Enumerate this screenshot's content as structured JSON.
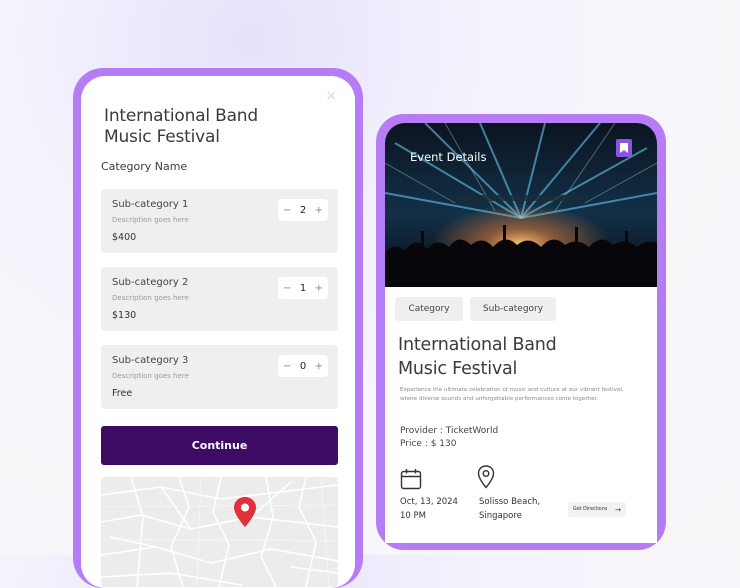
{
  "booking": {
    "title_line1": "International Band",
    "title_line2": "Music Festival",
    "close_label": "×",
    "category_name": "Category Name",
    "subcategories": [
      {
        "name": "Sub-category 1",
        "description": "Description goes here",
        "price": "$400",
        "quantity": "2"
      },
      {
        "name": "Sub-category 2",
        "description": "Description goes here",
        "price": "$130",
        "quantity": "1"
      },
      {
        "name": "Sub-category 3",
        "description": "Description goes here",
        "price": "Free",
        "quantity": "0"
      }
    ],
    "stepper_minus": "−",
    "stepper_plus": "+",
    "continue_label": "Continue",
    "map_pin_color": "#e0303a"
  },
  "event": {
    "header_title": "Event Details",
    "bookmark_icon": "bookmark-icon",
    "chips": [
      "Category",
      "Sub-category"
    ],
    "title_line1": "International Band",
    "title_line2": "Music Festival",
    "description": "Experience the ultimate celebration of music and culture at our vibrant festival, where diverse sounds and unforgettable performances come together.",
    "provider": "Provider : TicketWorld",
    "price": "Price : $ 130",
    "date_line1": "Oct, 13, 2024",
    "date_line2": "10 PM",
    "place_line1": "Solisso Beach,",
    "place_line2": "Singapore",
    "directions_label": "Get Directions",
    "directions_arrow": "→"
  },
  "colors": {
    "phone_frame": "#b57cf6",
    "continue_bg": "#3d0a64",
    "bookmark_bg": "#8a55e0"
  }
}
